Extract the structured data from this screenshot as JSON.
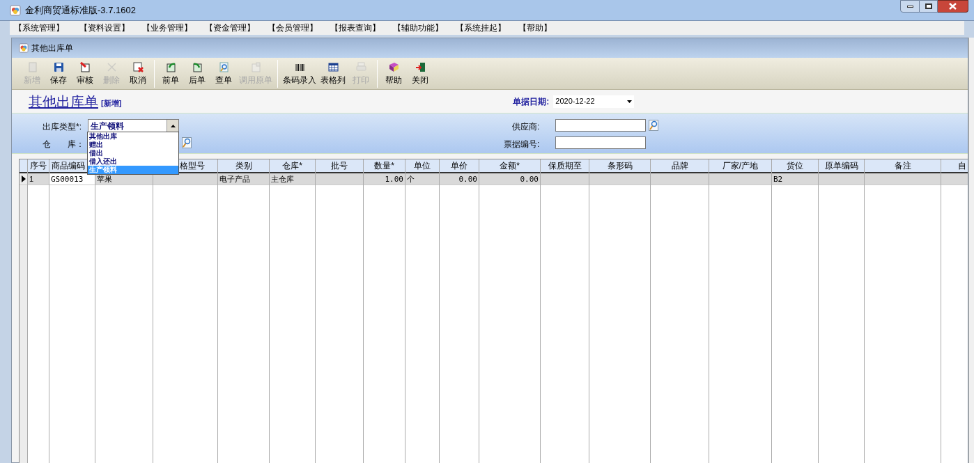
{
  "window": {
    "title": "金利商贸通标准版-3.7.1602"
  },
  "menu": [
    "【系统管理】",
    "【资料设置】",
    "【业务管理】",
    "【资金管理】",
    "【会员管理】",
    "【报表查询】",
    "【辅助功能】",
    "【系统挂起】",
    "【帮助】"
  ],
  "child_window": {
    "title": "其他出库单"
  },
  "toolbar": [
    [
      {
        "label": "新增",
        "disabled": true
      },
      {
        "label": "保存",
        "disabled": false
      },
      {
        "label": "审核",
        "disabled": false
      },
      {
        "label": "删除",
        "disabled": true
      },
      {
        "label": "取消",
        "disabled": false
      }
    ],
    [
      {
        "label": "前单",
        "disabled": false
      },
      {
        "label": "后单",
        "disabled": false
      },
      {
        "label": "查单",
        "disabled": false
      },
      {
        "label": "调用原单",
        "disabled": true
      }
    ],
    [
      {
        "label": "条码录入",
        "disabled": false
      },
      {
        "label": "表格列",
        "disabled": false
      },
      {
        "label": "打印",
        "disabled": true
      }
    ],
    [
      {
        "label": "帮助",
        "disabled": false
      },
      {
        "label": "关闭",
        "disabled": false
      }
    ]
  ],
  "form": {
    "heading": "其他出库单",
    "mode": "[新增]",
    "date_label": "单据日期:",
    "date_value": "2020-12-22",
    "type_label": "出库类型*:",
    "type_value": "生产领料",
    "warehouse_label": "仓　　库：",
    "supplier_label": "供应商:",
    "ticket_label": "票据编号:"
  },
  "type_dropdown": {
    "options": [
      {
        "label": "其他出库",
        "selected": false
      },
      {
        "label": "赠出",
        "selected": false
      },
      {
        "label": "借出",
        "selected": false
      },
      {
        "label": "借入还出",
        "selected": false
      },
      {
        "label": "生产领料",
        "selected": true
      }
    ]
  },
  "table": {
    "columns": [
      "序号",
      "商品编码",
      "",
      "格型号",
      "类别",
      "仓库*",
      "批号",
      "数量*",
      "单位",
      "单价",
      "金额*",
      "保质期至",
      "条形码",
      "品牌",
      "厂家/产地",
      "货位",
      "原单编码",
      "备注",
      "自"
    ],
    "rows": [
      {
        "current": true,
        "cells": [
          "1",
          "GS00013",
          "苹果",
          "",
          "电子产品",
          "主仓库",
          "",
          "1.00",
          "个",
          "0.00",
          "0.00",
          "",
          "",
          "",
          "",
          "B2",
          "",
          "",
          ""
        ]
      }
    ]
  }
}
